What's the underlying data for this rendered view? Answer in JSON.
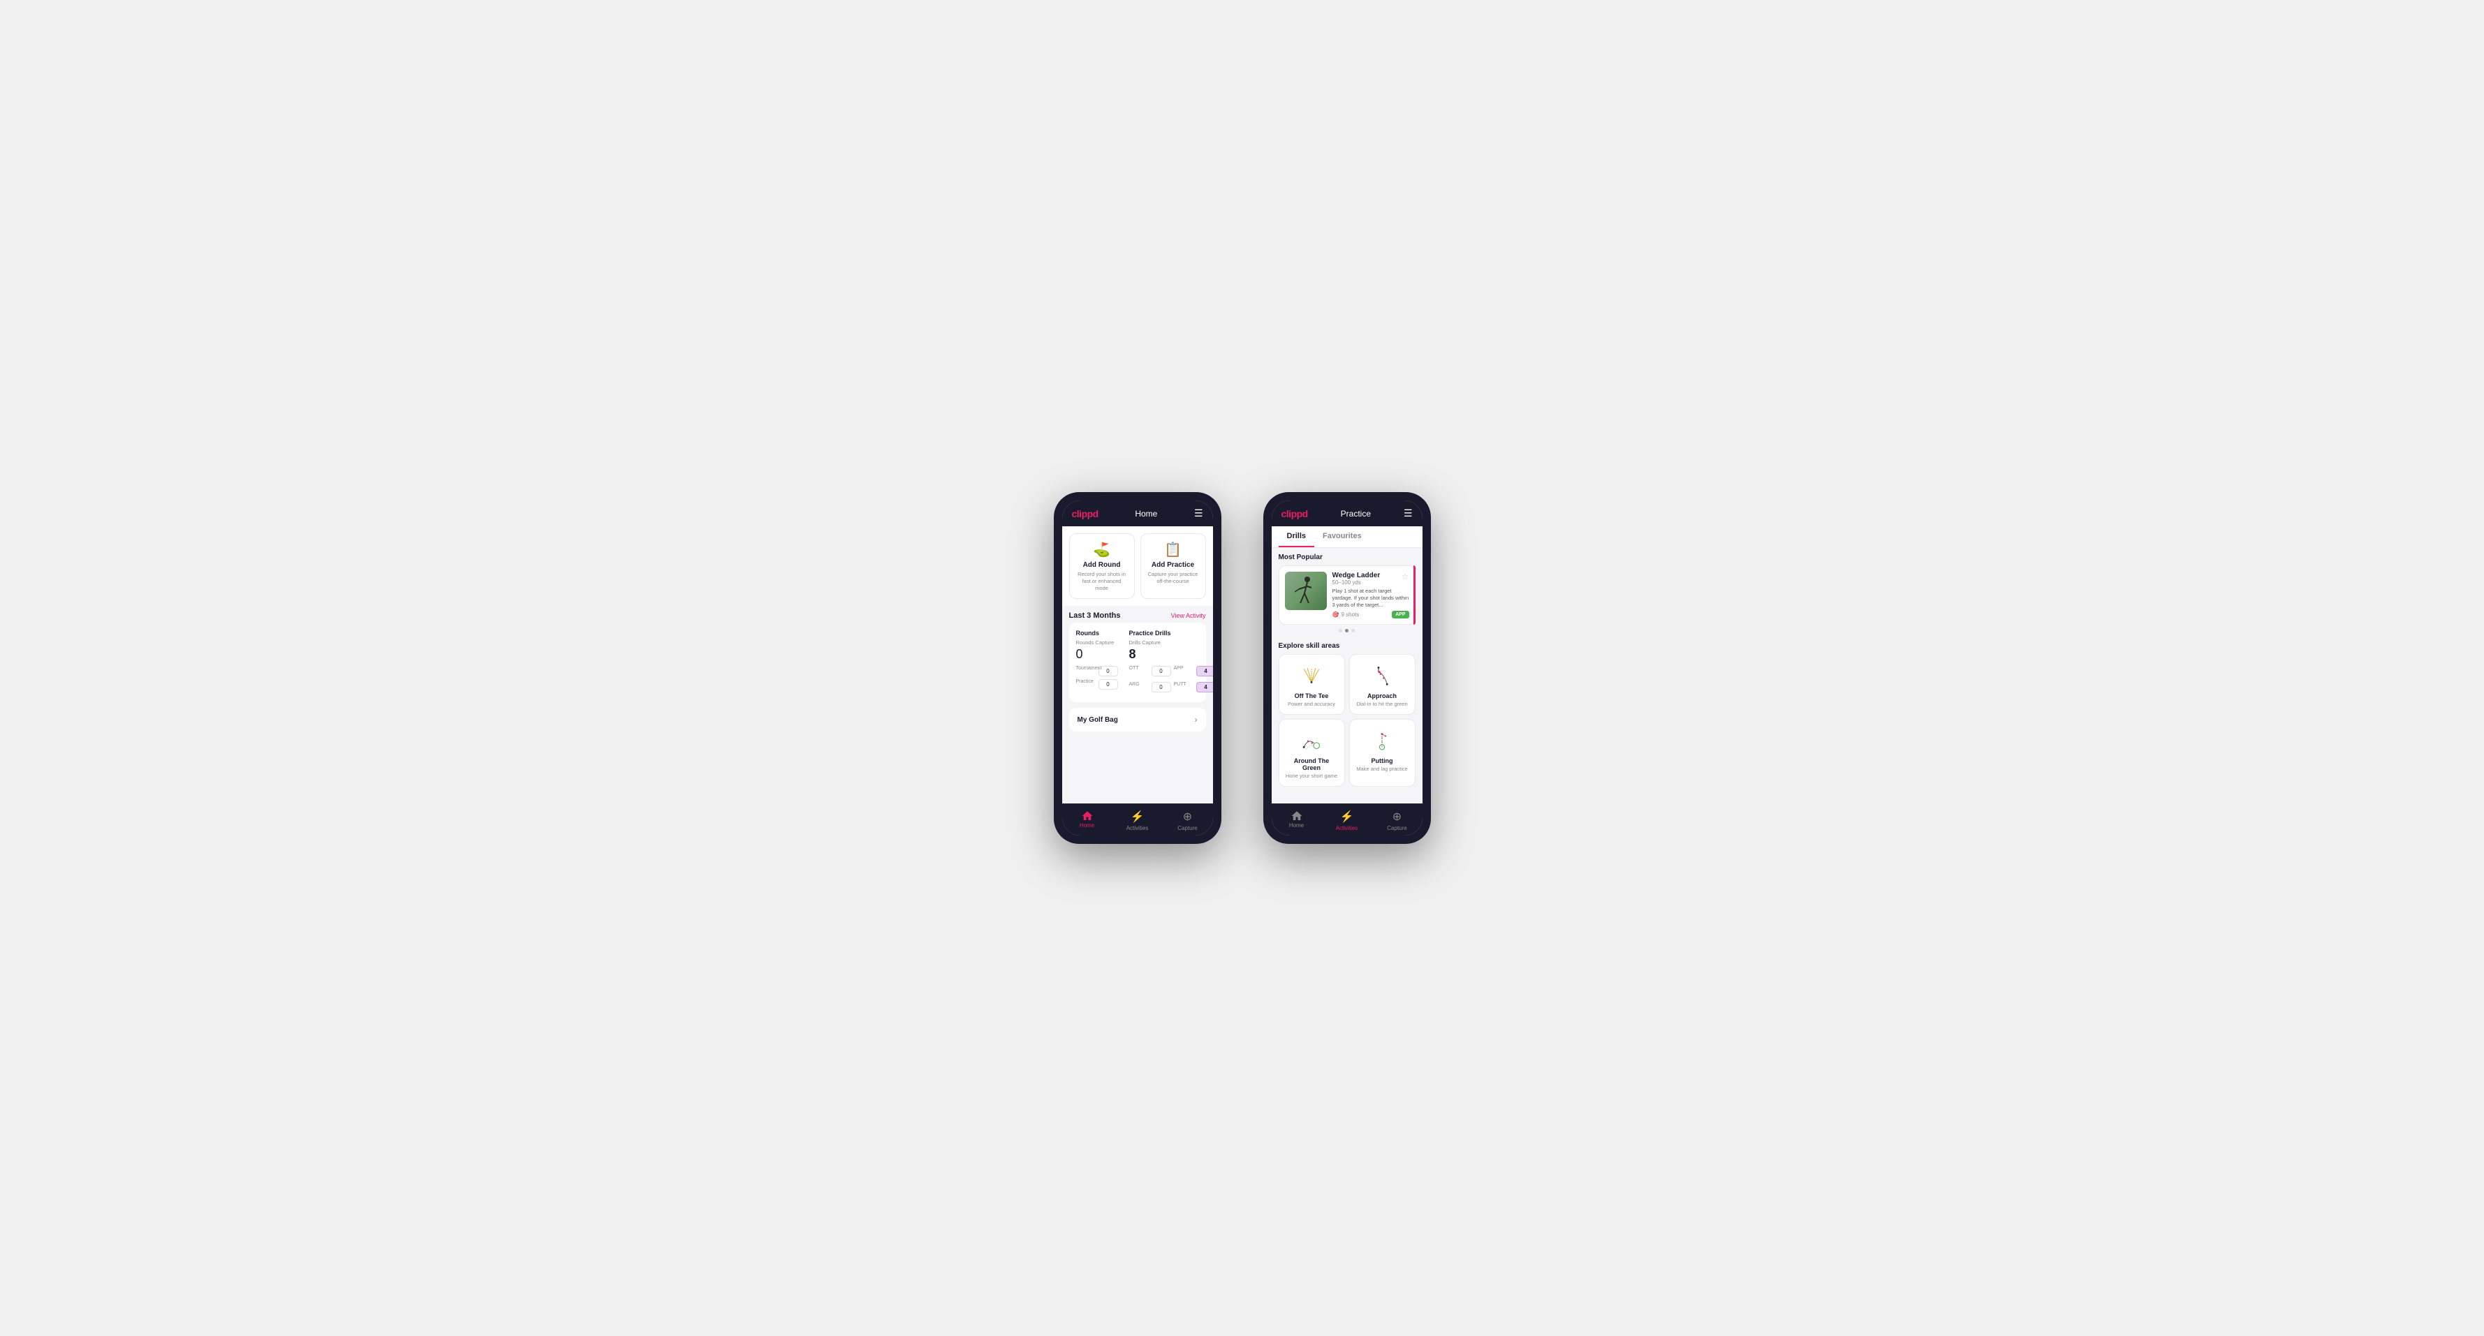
{
  "phone1": {
    "header": {
      "logo": "clippd",
      "title": "Home"
    },
    "quickActions": [
      {
        "id": "add-round",
        "icon": "⛳",
        "title": "Add Round",
        "description": "Record your shots in fast or enhanced mode"
      },
      {
        "id": "add-practice",
        "icon": "📋",
        "title": "Add Practice",
        "description": "Capture your practice off-the-course"
      }
    ],
    "activitySection": {
      "title": "Last 3 Months",
      "link": "View Activity"
    },
    "stats": {
      "rounds": {
        "title": "Rounds",
        "captureLabel": "Rounds Capture",
        "total": "0",
        "items": [
          {
            "label": "Tournament",
            "value": "0"
          },
          {
            "label": "Practice",
            "value": "0"
          }
        ]
      },
      "drills": {
        "title": "Practice Drills",
        "captureLabel": "Drills Capture",
        "total": "8",
        "items": [
          {
            "label": "OTT",
            "value": "0"
          },
          {
            "label": "APP",
            "value": "4",
            "highlighted": true
          },
          {
            "label": "ARG",
            "value": "0"
          },
          {
            "label": "PUTT",
            "value": "4",
            "highlighted": true
          }
        ]
      }
    },
    "golfBag": {
      "label": "My Golf Bag"
    },
    "nav": [
      {
        "id": "home",
        "label": "Home",
        "icon": "🏠",
        "active": true
      },
      {
        "id": "activities",
        "label": "Activities",
        "icon": "⚡",
        "active": false
      },
      {
        "id": "capture",
        "label": "Capture",
        "icon": "➕",
        "active": false
      }
    ]
  },
  "phone2": {
    "header": {
      "logo": "clippd",
      "title": "Practice"
    },
    "tabs": [
      {
        "id": "drills",
        "label": "Drills",
        "active": true
      },
      {
        "id": "favourites",
        "label": "Favourites",
        "active": false
      }
    ],
    "mostPopular": {
      "title": "Most Popular",
      "drill": {
        "name": "Wedge Ladder",
        "range": "50–100 yds",
        "description": "Play 1 shot at each target yardage. If your shot lands within 3 yards of the target...",
        "shots": "9 shots",
        "badge": "APP"
      },
      "dots": [
        {
          "active": false
        },
        {
          "active": true
        },
        {
          "active": false
        }
      ]
    },
    "skillAreas": {
      "title": "Explore skill areas",
      "items": [
        {
          "id": "off-the-tee",
          "name": "Off The Tee",
          "description": "Power and accuracy",
          "iconType": "tee"
        },
        {
          "id": "approach",
          "name": "Approach",
          "description": "Dial-in to hit the green",
          "iconType": "approach"
        },
        {
          "id": "around-the-green",
          "name": "Around The Green",
          "description": "Hone your short game",
          "iconType": "atg"
        },
        {
          "id": "putting",
          "name": "Putting",
          "description": "Make and lag practice",
          "iconType": "putt"
        }
      ]
    },
    "nav": [
      {
        "id": "home",
        "label": "Home",
        "icon": "🏠",
        "active": false
      },
      {
        "id": "activities",
        "label": "Activities",
        "icon": "⚡",
        "active": true
      },
      {
        "id": "capture",
        "label": "Capture",
        "icon": "➕",
        "active": false
      }
    ]
  }
}
